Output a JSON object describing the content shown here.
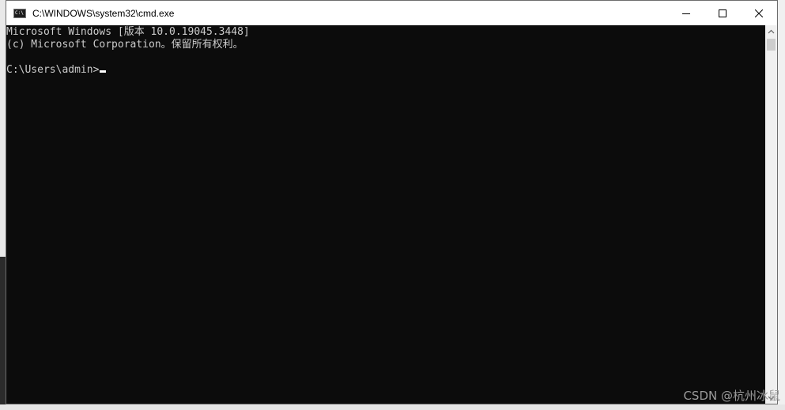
{
  "window": {
    "title": "C:\\WINDOWS\\system32\\cmd.exe",
    "app_icon_text": "C:\\",
    "minimize_icon": "minimize-icon",
    "maximize_icon": "maximize-icon",
    "close_icon": "close-icon"
  },
  "console": {
    "lines": [
      "Microsoft Windows [版本 10.0.19045.3448]",
      "(c) Microsoft Corporation。保留所有权利。",
      "",
      "C:\\Users\\admin>"
    ],
    "background_color": "#0c0c0c",
    "text_color": "#cccccc"
  },
  "scrollbar": {
    "up_icon": "scroll-up-icon",
    "down_icon": "scroll-down-icon"
  },
  "watermark": {
    "text": "CSDN @杭州冰鼠"
  }
}
